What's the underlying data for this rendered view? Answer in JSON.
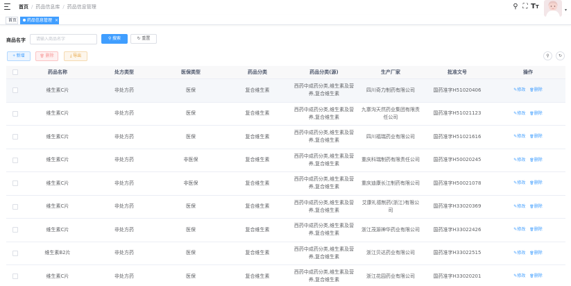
{
  "header": {
    "breadcrumb": [
      "首页",
      "药品信息库",
      "药品信息管理"
    ],
    "icons": [
      "search-icon",
      "fullscreen-icon",
      "font-size-icon",
      "avatar",
      "caret-down-icon"
    ],
    "search_glyph": "⚲",
    "fullscreen_glyph": "⛶",
    "font_glyph": "T",
    "font_glyph_sub": "T",
    "caret_glyph": "▾"
  },
  "tags": {
    "home": "首页",
    "active": "药品信息管理",
    "active_close": "×"
  },
  "search": {
    "label": "商品名字",
    "placeholder": "请输入商品名字",
    "search_button": "搜索",
    "search_icon": "⚲",
    "reset_button": "重置",
    "reset_icon": "↻"
  },
  "toolbar": {
    "add": "新增",
    "add_icon": "+",
    "delete": "删除",
    "delete_icon": "🗑",
    "export": "导出",
    "export_icon": "⤓",
    "toggle_search_icon": "⚲",
    "refresh_icon": "↻"
  },
  "table": {
    "columns": [
      "药品名称",
      "处方类型",
      "医保类型",
      "药品分类",
      "药品分类(源)",
      "生产厂家",
      "批准文号",
      "操作"
    ],
    "edit_label": "修改",
    "edit_icon": "✎",
    "delete_label": "删除",
    "delete_icon": "🗑",
    "rows": [
      {
        "name": "维生素C片",
        "rx": "非处方药",
        "ins": "医保",
        "cat": "复合维生素",
        "cat_src": "西药中成药分类,维生素及营养,复合维生素",
        "maker": "四川奇力制药有限公司",
        "approval": "国药准字H51020406"
      },
      {
        "name": "维生素C片",
        "rx": "非处方药",
        "ins": "医保",
        "cat": "复合维生素",
        "cat_src": "西药中成药分类,维生素及营养,复合维生素",
        "maker": "九寨沟天然药业集团有限责任公司",
        "approval": "国药准字H51021123"
      },
      {
        "name": "维生素C片",
        "rx": "非处方药",
        "ins": "医保",
        "cat": "复合维生素",
        "cat_src": "西药中成药分类,维生素及营养,复合维生素",
        "maker": "四川福瑞药业有限公司",
        "approval": "国药准字H51021616"
      },
      {
        "name": "维生素C片",
        "rx": "非处方药",
        "ins": "非医保",
        "cat": "复合维生素",
        "cat_src": "西药中成药分类,维生素及营养,复合维生素",
        "maker": "重庆科瑞制药有限责任公司",
        "approval": "国药准字H50020245"
      },
      {
        "name": "维生素C片",
        "rx": "非处方药",
        "ins": "非医保",
        "cat": "复合维生素",
        "cat_src": "西药中成药分类,维生素及营养,复合维生素",
        "maker": "重庆迪康长江制药有限公司",
        "approval": "国药准字H50021078"
      },
      {
        "name": "维生素C片",
        "rx": "非处方药",
        "ins": "医保",
        "cat": "复合维生素",
        "cat_src": "西药中成药分类,维生素及营养,复合维生素",
        "maker": "艾康礼德制药(浙江)有限公司",
        "approval": "国药准字H33020369"
      },
      {
        "name": "维生素C片",
        "rx": "非处方药",
        "ins": "医保",
        "cat": "复合维生素",
        "cat_src": "西药中成药分类,维生素及营养,复合维生素",
        "maker": "浙江茂源神华药业有限公司",
        "approval": "国药准字H33022426"
      },
      {
        "name": "维生素B2片",
        "rx": "非处方药",
        "ins": "医保",
        "cat": "复合维生素",
        "cat_src": "西药中成药分类,维生素及营养,复合维生素",
        "maker": "浙江贝达药业有限公司",
        "approval": "国药准字H33022515"
      },
      {
        "name": "维生素C片",
        "rx": "非处方药",
        "ins": "医保",
        "cat": "复合维生素",
        "cat_src": "西药中成药分类,维生素及营养,复合维生素",
        "maker": "浙江花园药业有限公司",
        "approval": "国药准字H33020201"
      }
    ]
  },
  "colors": {
    "primary": "#409eff",
    "danger": "#f89898",
    "warning": "#e6a23c",
    "border": "#ebeef5",
    "header_bg": "#f8f8f9",
    "hover_bg": "#f5f7fa"
  }
}
